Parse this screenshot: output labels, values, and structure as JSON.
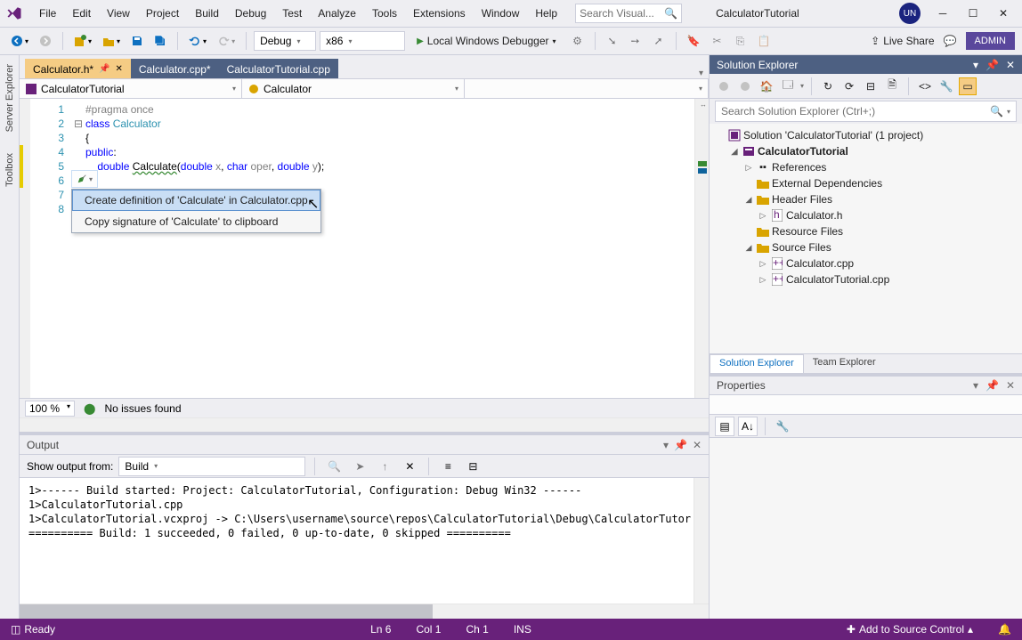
{
  "menu": [
    "File",
    "Edit",
    "View",
    "Project",
    "Build",
    "Debug",
    "Test",
    "Analyze",
    "Tools",
    "Extensions",
    "Window",
    "Help"
  ],
  "title_search_placeholder": "Search Visual...",
  "solution_name_title": "CalculatorTutorial",
  "avatar_initials": "UN",
  "admin_label": "ADMIN",
  "liveshare_label": "Live Share",
  "toolbar": {
    "config": "Debug",
    "platform": "x86",
    "run": "Local Windows Debugger"
  },
  "tabs": [
    {
      "label": "Calculator.h*",
      "active": true,
      "pinned": true
    },
    {
      "label": "Calculator.cpp*",
      "active": false
    },
    {
      "label": "CalculatorTutorial.cpp",
      "active": false
    }
  ],
  "nav": {
    "project": "CalculatorTutorial",
    "class": "Calculator",
    "member": ""
  },
  "code_lines": [
    {
      "n": 1,
      "raw": [
        "pc",
        "#pragma once"
      ]
    },
    {
      "n": 2,
      "raw": [
        "kw",
        "class",
        " ",
        "ty",
        "Calculator"
      ]
    },
    {
      "n": 3,
      "raw": [
        "p",
        "{"
      ]
    },
    {
      "n": 4,
      "raw": [
        "kw",
        "public",
        "p",
        ":"
      ]
    },
    {
      "n": 5,
      "raw": [
        "",
        "    ",
        "kw",
        "double",
        " ",
        "fn",
        "Calculate",
        "p",
        "(",
        "kw",
        "double ",
        "param",
        "x",
        "p",
        ", ",
        "kw",
        "char ",
        "param",
        "oper",
        "p",
        ", ",
        "kw",
        "double ",
        "param",
        "y",
        "p",
        ");"
      ]
    },
    {
      "n": 6,
      "raw": [
        "p",
        "};"
      ]
    },
    {
      "n": 7,
      "raw": [
        "",
        ""
      ]
    },
    {
      "n": 8,
      "raw": [
        "",
        ""
      ]
    }
  ],
  "context_menu": [
    "Create definition of 'Calculate' in Calculator.cpp",
    "Copy signature of 'Calculate' to clipboard"
  ],
  "editor_status": {
    "zoom": "100 %",
    "issues": "No issues found"
  },
  "output": {
    "title": "Output",
    "from_label": "Show output from:",
    "from_value": "Build",
    "text": "1>------ Build started: Project: CalculatorTutorial, Configuration: Debug Win32 ------\n1>CalculatorTutorial.cpp\n1>CalculatorTutorial.vcxproj -> C:\\Users\\username\\source\\repos\\CalculatorTutorial\\Debug\\CalculatorTutor\n========== Build: 1 succeeded, 0 failed, 0 up-to-date, 0 skipped =========="
  },
  "left_rail": [
    "Server Explorer",
    "Toolbox"
  ],
  "solution_explorer": {
    "title": "Solution Explorer",
    "search_placeholder": "Search Solution Explorer (Ctrl+;)",
    "root": "Solution 'CalculatorTutorial' (1 project)",
    "project": "CalculatorTutorial",
    "nodes": [
      {
        "label": "References",
        "icon": "ref"
      },
      {
        "label": "External Dependencies",
        "icon": "ext"
      },
      {
        "label": "Header Files",
        "icon": "folder",
        "expanded": true,
        "children": [
          {
            "label": "Calculator.h",
            "icon": "h"
          }
        ]
      },
      {
        "label": "Resource Files",
        "icon": "folder"
      },
      {
        "label": "Source Files",
        "icon": "folder",
        "expanded": true,
        "children": [
          {
            "label": "Calculator.cpp",
            "icon": "cpp"
          },
          {
            "label": "CalculatorTutorial.cpp",
            "icon": "cpp"
          }
        ]
      }
    ]
  },
  "panel_tabs": [
    "Solution Explorer",
    "Team Explorer"
  ],
  "properties_title": "Properties",
  "statusbar": {
    "ready": "Ready",
    "ln": "Ln 6",
    "col": "Col 1",
    "ch": "Ch 1",
    "ins": "INS",
    "source_control": "Add to Source Control"
  }
}
